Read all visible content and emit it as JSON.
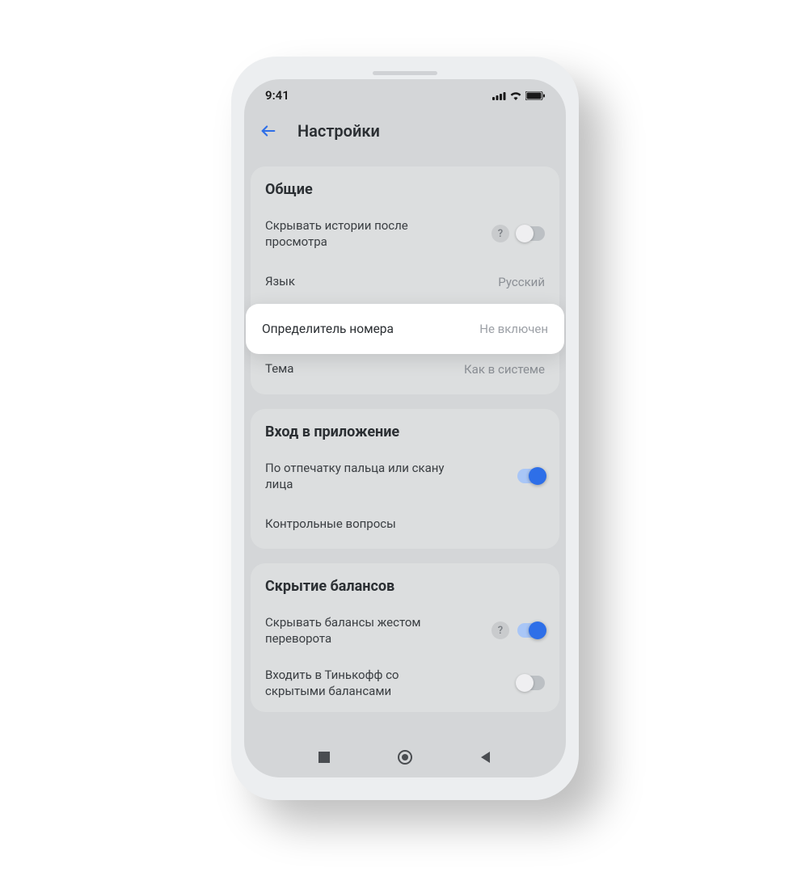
{
  "status": {
    "time": "9:41"
  },
  "header": {
    "title": "Настройки"
  },
  "sections": {
    "general": {
      "title": "Общие",
      "hide_stories_label": "Скрывать истории после просмотра",
      "language_label": "Язык",
      "language_value": "Русский",
      "caller_id_label": "Определитель номера",
      "caller_id_value": "Не включен",
      "theme_label": "Тема",
      "theme_value": "Как в системе"
    },
    "login": {
      "title": "Вход в приложение",
      "biometric_label": "По отпечатку пальца или скану лица",
      "security_questions_label": "Контрольные вопросы"
    },
    "balances": {
      "title": "Скрытие балансов",
      "hide_gesture_label": "Скрывать балансы жестом переворота",
      "login_hidden_label": "Входить в Тинькофф со скрытыми балансами"
    }
  },
  "toggles": {
    "hide_stories": false,
    "biometric": true,
    "hide_gesture": true,
    "login_hidden": false
  },
  "icons": {
    "help": "?"
  }
}
